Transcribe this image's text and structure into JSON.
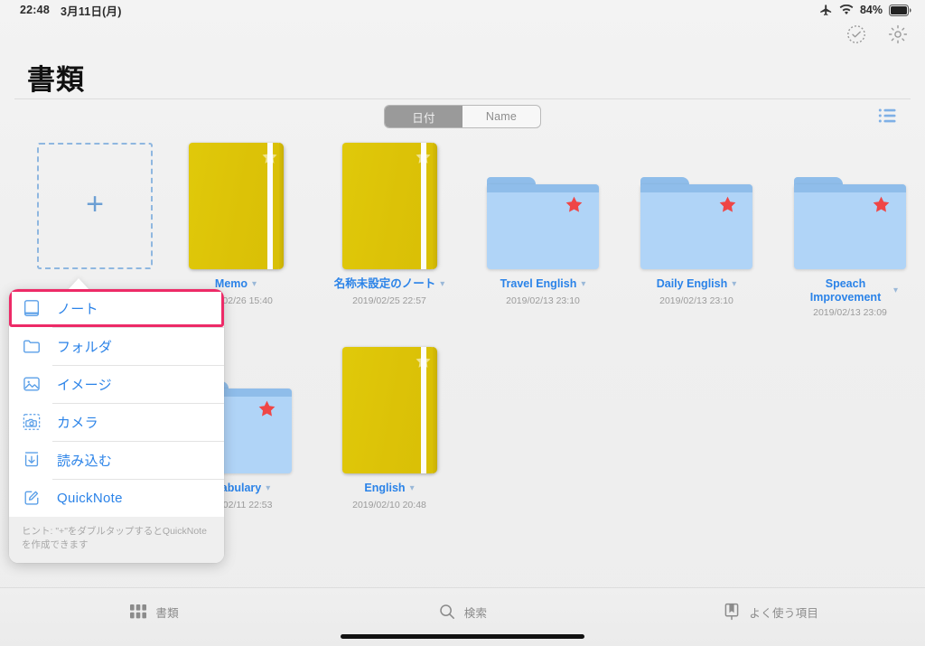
{
  "status_bar": {
    "time": "22:48",
    "date": "3月11日(月)",
    "airplane_icon": "airplane-icon",
    "wifi_icon": "wifi-icon",
    "battery_percent": "84%",
    "battery_icon": "battery-icon"
  },
  "nav": {
    "select_icon": "select-circle-check-icon",
    "settings_icon": "gear-icon"
  },
  "header": {
    "title": "書類"
  },
  "toolbar": {
    "sort_segments": [
      {
        "label": "日付",
        "selected": true
      },
      {
        "label": "Name",
        "selected": false
      }
    ],
    "listview_icon": "list-view-icon"
  },
  "grid": {
    "add_tile": {
      "label": "+",
      "name": "add-document-tile"
    },
    "items": [
      {
        "kind": "notebook",
        "title": "Memo",
        "date": "2019/02/26 15:40",
        "starred": true
      },
      {
        "kind": "notebook",
        "title": "名称未設定のノート",
        "date": "2019/02/25 22:57",
        "starred": true
      },
      {
        "kind": "folder",
        "title": "Travel English",
        "date": "2019/02/13 23:10",
        "starred": true
      },
      {
        "kind": "folder",
        "title": "Daily English",
        "date": "2019/02/13 23:10",
        "starred": true
      },
      {
        "kind": "folder",
        "title": "Speach Improvement",
        "date": "2019/02/13 23:09",
        "starred": true
      },
      {
        "kind": "folder",
        "title": "Vocabulary",
        "date": "2019/02/11 22:53",
        "starred": true
      },
      {
        "kind": "notebook",
        "title": "English",
        "date": "2019/02/10 20:48",
        "starred": true
      }
    ]
  },
  "popup_menu": {
    "items": [
      {
        "label": "ノート",
        "icon": "notebook-icon",
        "highlighted": true
      },
      {
        "label": "フォルダ",
        "icon": "folder-icon",
        "highlighted": false
      },
      {
        "label": "イメージ",
        "icon": "image-icon",
        "highlighted": false
      },
      {
        "label": "カメラ",
        "icon": "camera-icon",
        "highlighted": false
      },
      {
        "label": "読み込む",
        "icon": "import-icon",
        "highlighted": false
      },
      {
        "label": "QuickNote",
        "icon": "quicknote-icon",
        "highlighted": false
      }
    ],
    "hint": "ヒント: \"+\"をダブルタップするとQuickNoteを作成できます",
    "highlight_color": "#ed2a67"
  },
  "tab_bar": {
    "tabs": [
      {
        "label": "書類",
        "icon": "grid-icon",
        "active": true
      },
      {
        "label": "検索",
        "icon": "search-icon",
        "active": false
      },
      {
        "label": "よく使う項目",
        "icon": "bookmark-icon",
        "active": false
      }
    ]
  },
  "colors": {
    "accent_blue": "#2b83e8",
    "notebook_yellow": "#dcc207",
    "folder_blue": "#b0d4f7",
    "star_red": "#ef4646",
    "highlight_pink": "#ed2a67"
  }
}
